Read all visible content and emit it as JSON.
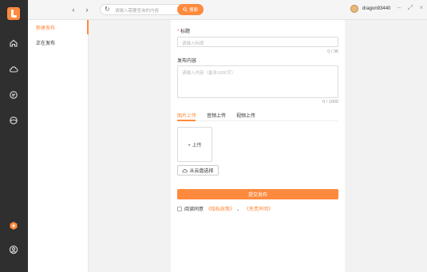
{
  "topbar": {
    "search_placeholder": "请输入需要查询的内容",
    "search_button": "搜索",
    "username": "dragon93440"
  },
  "subnav": [
    {
      "label": "新建发布"
    },
    {
      "label": "正在发布"
    }
  ],
  "form": {
    "title_label": "标题",
    "title_placeholder": "请输入标题",
    "title_counter": "0 / 36",
    "content_label": "发布内容",
    "content_placeholder": "请输入内容（最多1000字）",
    "content_counter": "0 / 1000",
    "tabs": [
      {
        "label": "图片上传"
      },
      {
        "label": "音频上传"
      },
      {
        "label": "视频上传"
      }
    ],
    "upload_label": "+ 上传",
    "cloud_button": "从云盘选择",
    "submit_button": "提交发布",
    "agree_text": "阅读同意",
    "privacy_link": "《隐私政策》",
    "separator": "、",
    "disclaimer_link": "《免责声明》"
  },
  "colors": {
    "accent": "#ff8a3d",
    "sidebar": "#2f2f2f"
  }
}
